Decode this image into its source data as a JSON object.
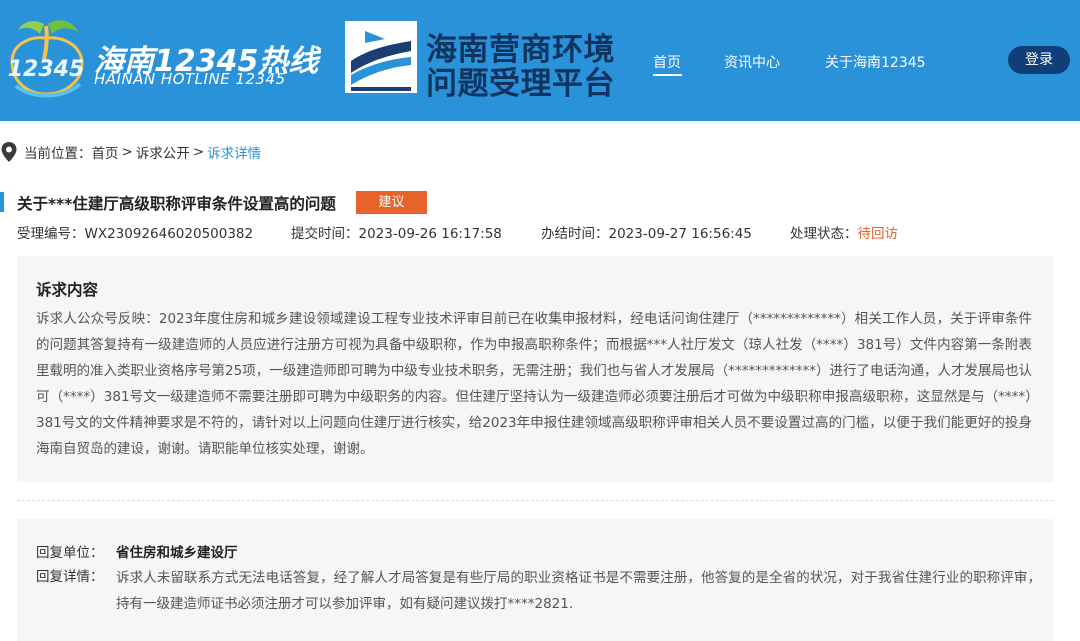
{
  "header": {
    "logo1": {
      "mark_text": "12345",
      "cn": "海南12345热线",
      "en": "HAINAN HOTLINE 12345"
    },
    "logo2": {
      "line1": "海南营商环境",
      "line2": "问题受理平台"
    },
    "nav": {
      "home": "首页",
      "news": "资讯中心",
      "about": "关于海南12345"
    },
    "login_label": "登录"
  },
  "breadcrumb": {
    "prefix": "当前位置：",
    "home": "首页",
    "section": "诉求公开",
    "current": "诉求详情",
    "separator": ">"
  },
  "detail": {
    "title": "关于***住建厅高级职称评审条件设置高的问题",
    "tag": "建议",
    "meta": {
      "id_label": "受理编号：",
      "id_value": "WX23092646020500382",
      "submit_label": "提交时间：",
      "submit_value": "2023-09-26 16:17:58",
      "done_label": "办结时间：",
      "done_value": "2023-09-27 16:56:45",
      "status_label": "处理状态：",
      "status_value": "待回访"
    },
    "content_heading": "诉求内容",
    "content_body": "诉求人公众号反映：2023年度住房和城乡建设领域建设工程专业技术评审目前已在收集申报材料，经电话问询住建厅（*************）相关工作人员，关于评审条件的问题其答复持有一级建造师的人员应进行注册方可视为具备中级职称，作为申报高职称条件；而根据***人社厅发文（琼人社发（****）381号）文件内容第一条附表里载明的准入类职业资格序号第25项，一级建造师即可聘为中级专业技术职务，无需注册；我们也与省人才发展局（*************）进行了电话沟通，人才发展局也认可（****）381号文一级建造师不需要注册即可聘为中级职务的内容。但住建厅坚持认为一级建造师必须要注册后才可做为中级职称申报高级职称，这显然是与（****）381号文的文件精神要求是不符的，请针对以上问题向住建厅进行核实，给2023年申报住建领域高级职称评审相关人员不要设置过高的门槛，以便于我们能更好的投身海南自贸岛的建设，谢谢。请职能单位核实处理，谢谢。",
    "reply": {
      "unit_label": "回复单位：",
      "unit_value": "省住房和城乡建设厅",
      "detail_label": "回复详情：",
      "detail_value": "诉求人未留联系方式无法电话答复，经了解人才局答复是有些厅局的职业资格证书是不需要注册，他答复的是全省的状况，对于我省住建行业的职称评审，持有一级建造师证书必须注册才可以参加评审，如有疑问建议拨打****2821."
    }
  },
  "colors": {
    "header_bg": "#2a92d8",
    "login_bg": "#0f3e78",
    "accent": "#2a92d8",
    "tag_bg": "#e8632c",
    "status": "#e8632c",
    "panel_bg": "#f4f6f8"
  },
  "icons": [
    "hotline-logo-icon",
    "platform-logo-icon",
    "location-pin-icon"
  ]
}
